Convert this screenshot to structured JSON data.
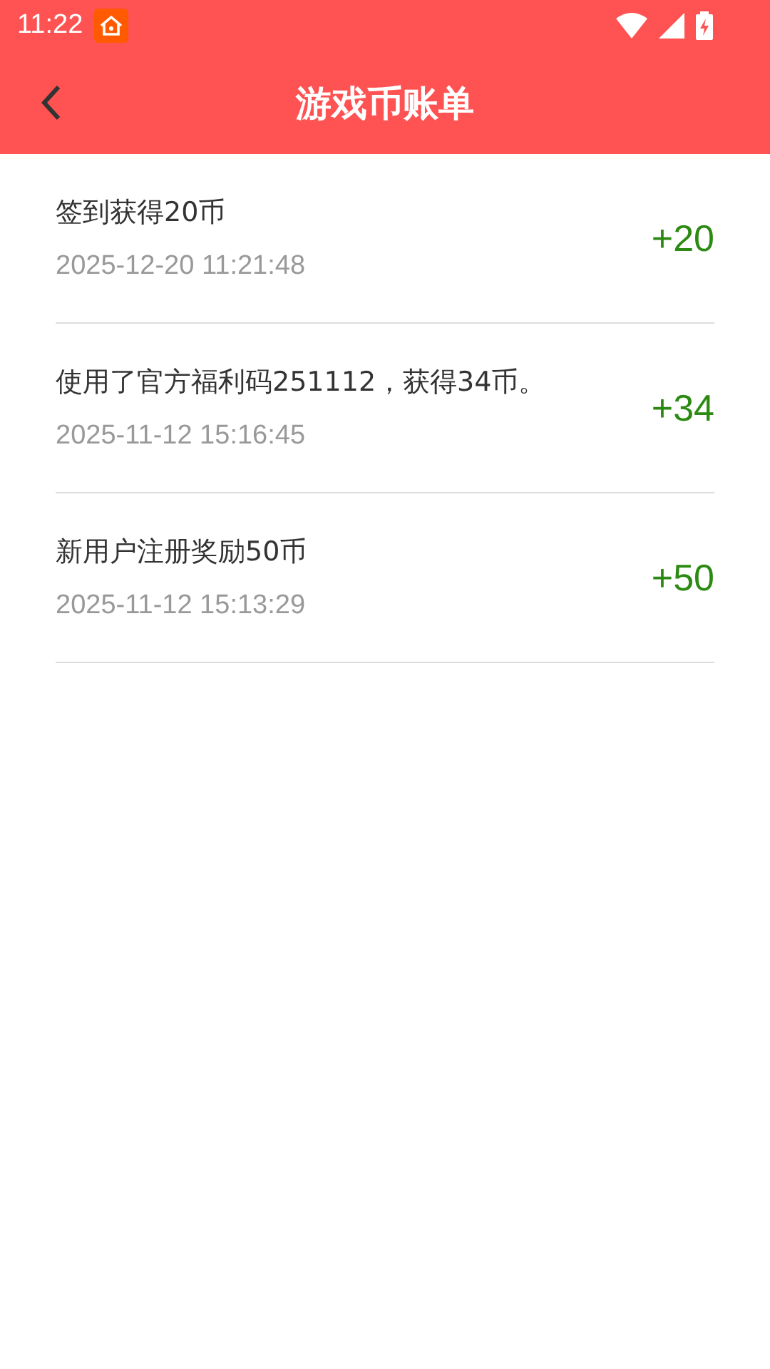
{
  "status_bar": {
    "time": "11:22"
  },
  "header": {
    "title": "游戏币账单"
  },
  "records": [
    {
      "description": "签到获得20币",
      "time": "2025-12-20 11:21:48",
      "amount": "+20"
    },
    {
      "description": "使用了官方福利码251112，获得34币。",
      "time": "2025-11-12 15:16:45",
      "amount": "+34"
    },
    {
      "description": "新用户注册奖励50币",
      "time": "2025-11-12 15:13:29",
      "amount": "+50"
    }
  ]
}
